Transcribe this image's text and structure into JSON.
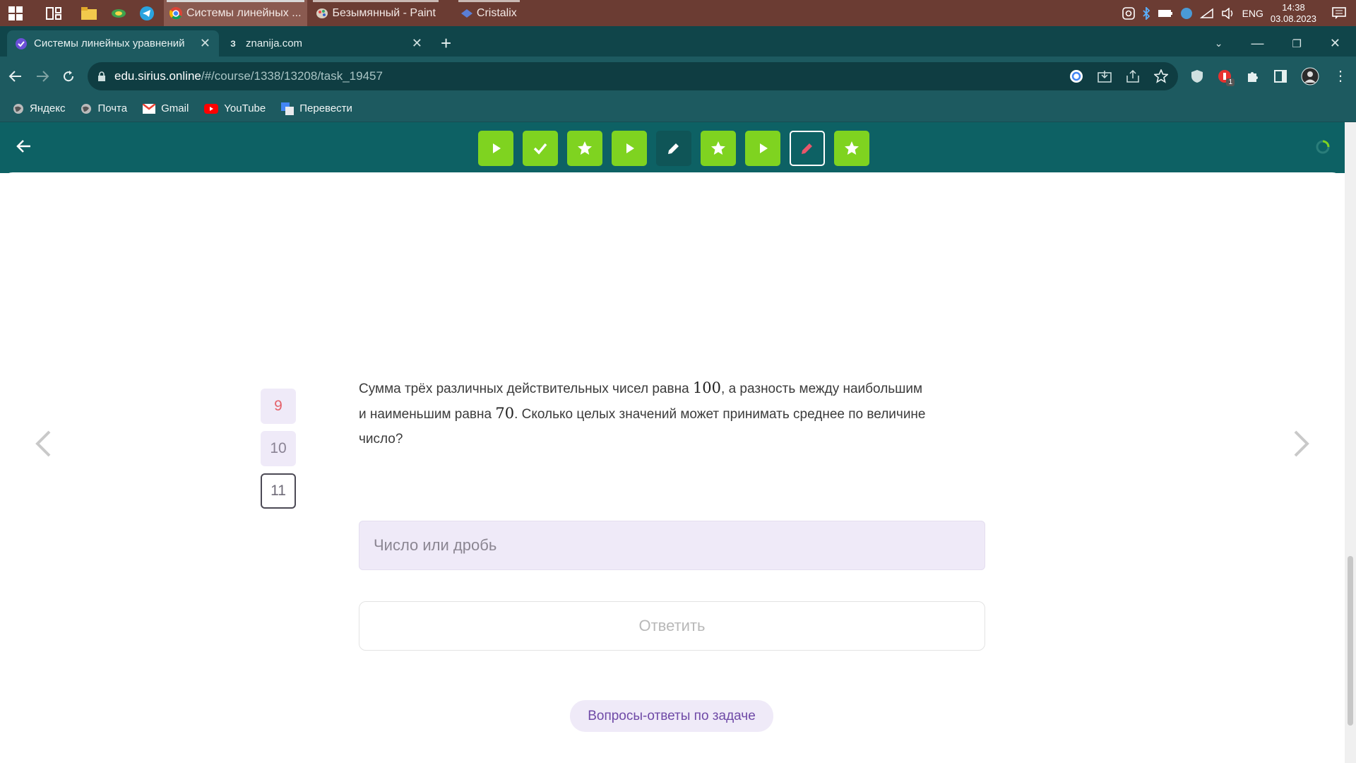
{
  "taskbar": {
    "apps": [
      {
        "label": "Системы линейных ...",
        "active": true
      },
      {
        "label": "Безымянный - Paint",
        "active": false
      },
      {
        "label": "Cristalix",
        "active": false
      }
    ],
    "lang": "ENG",
    "time": "14:38",
    "date": "03.08.2023"
  },
  "browser": {
    "tabs": [
      {
        "title": "Системы линейных уравнений",
        "active": true
      },
      {
        "title": "znanija.com",
        "favicon": "З",
        "active": false
      }
    ],
    "url_host": "edu.sirius.online",
    "url_path": "/#/course/1338/13208/task_19457",
    "extension_badge": "1",
    "bookmarks": [
      "Яндекс",
      "Почта",
      "Gmail",
      "YouTube",
      "Перевести"
    ]
  },
  "steps": [
    {
      "icon": "play-icon",
      "state": "done"
    },
    {
      "icon": "check-icon",
      "state": "done"
    },
    {
      "icon": "star-icon",
      "state": "done"
    },
    {
      "icon": "play-icon",
      "state": "done"
    },
    {
      "icon": "pencil-icon",
      "state": "dark"
    },
    {
      "icon": "star-icon",
      "state": "done"
    },
    {
      "icon": "play-icon",
      "state": "done"
    },
    {
      "icon": "pencil-icon",
      "state": "current"
    },
    {
      "icon": "star-icon",
      "state": "done"
    }
  ],
  "question_numbers": [
    "9",
    "10",
    "11"
  ],
  "question": {
    "part1": "Сумма трёх различных действительных чисел равна ",
    "n1": "100",
    "part2": ", а разность между наибольшим",
    "part3": "и наименьшим равна ",
    "n2": "70",
    "part4": ". Сколько целых значений может принимать среднее по величине",
    "part5": "число?"
  },
  "answer": {
    "placeholder": "Число или дробь",
    "submit_label": "Ответить"
  },
  "qa_link": "Вопросы-ответы по задаче",
  "colors": {
    "header": "#0d6164",
    "step_green": "#7fd320",
    "accent_purple": "#6f4aa7"
  }
}
